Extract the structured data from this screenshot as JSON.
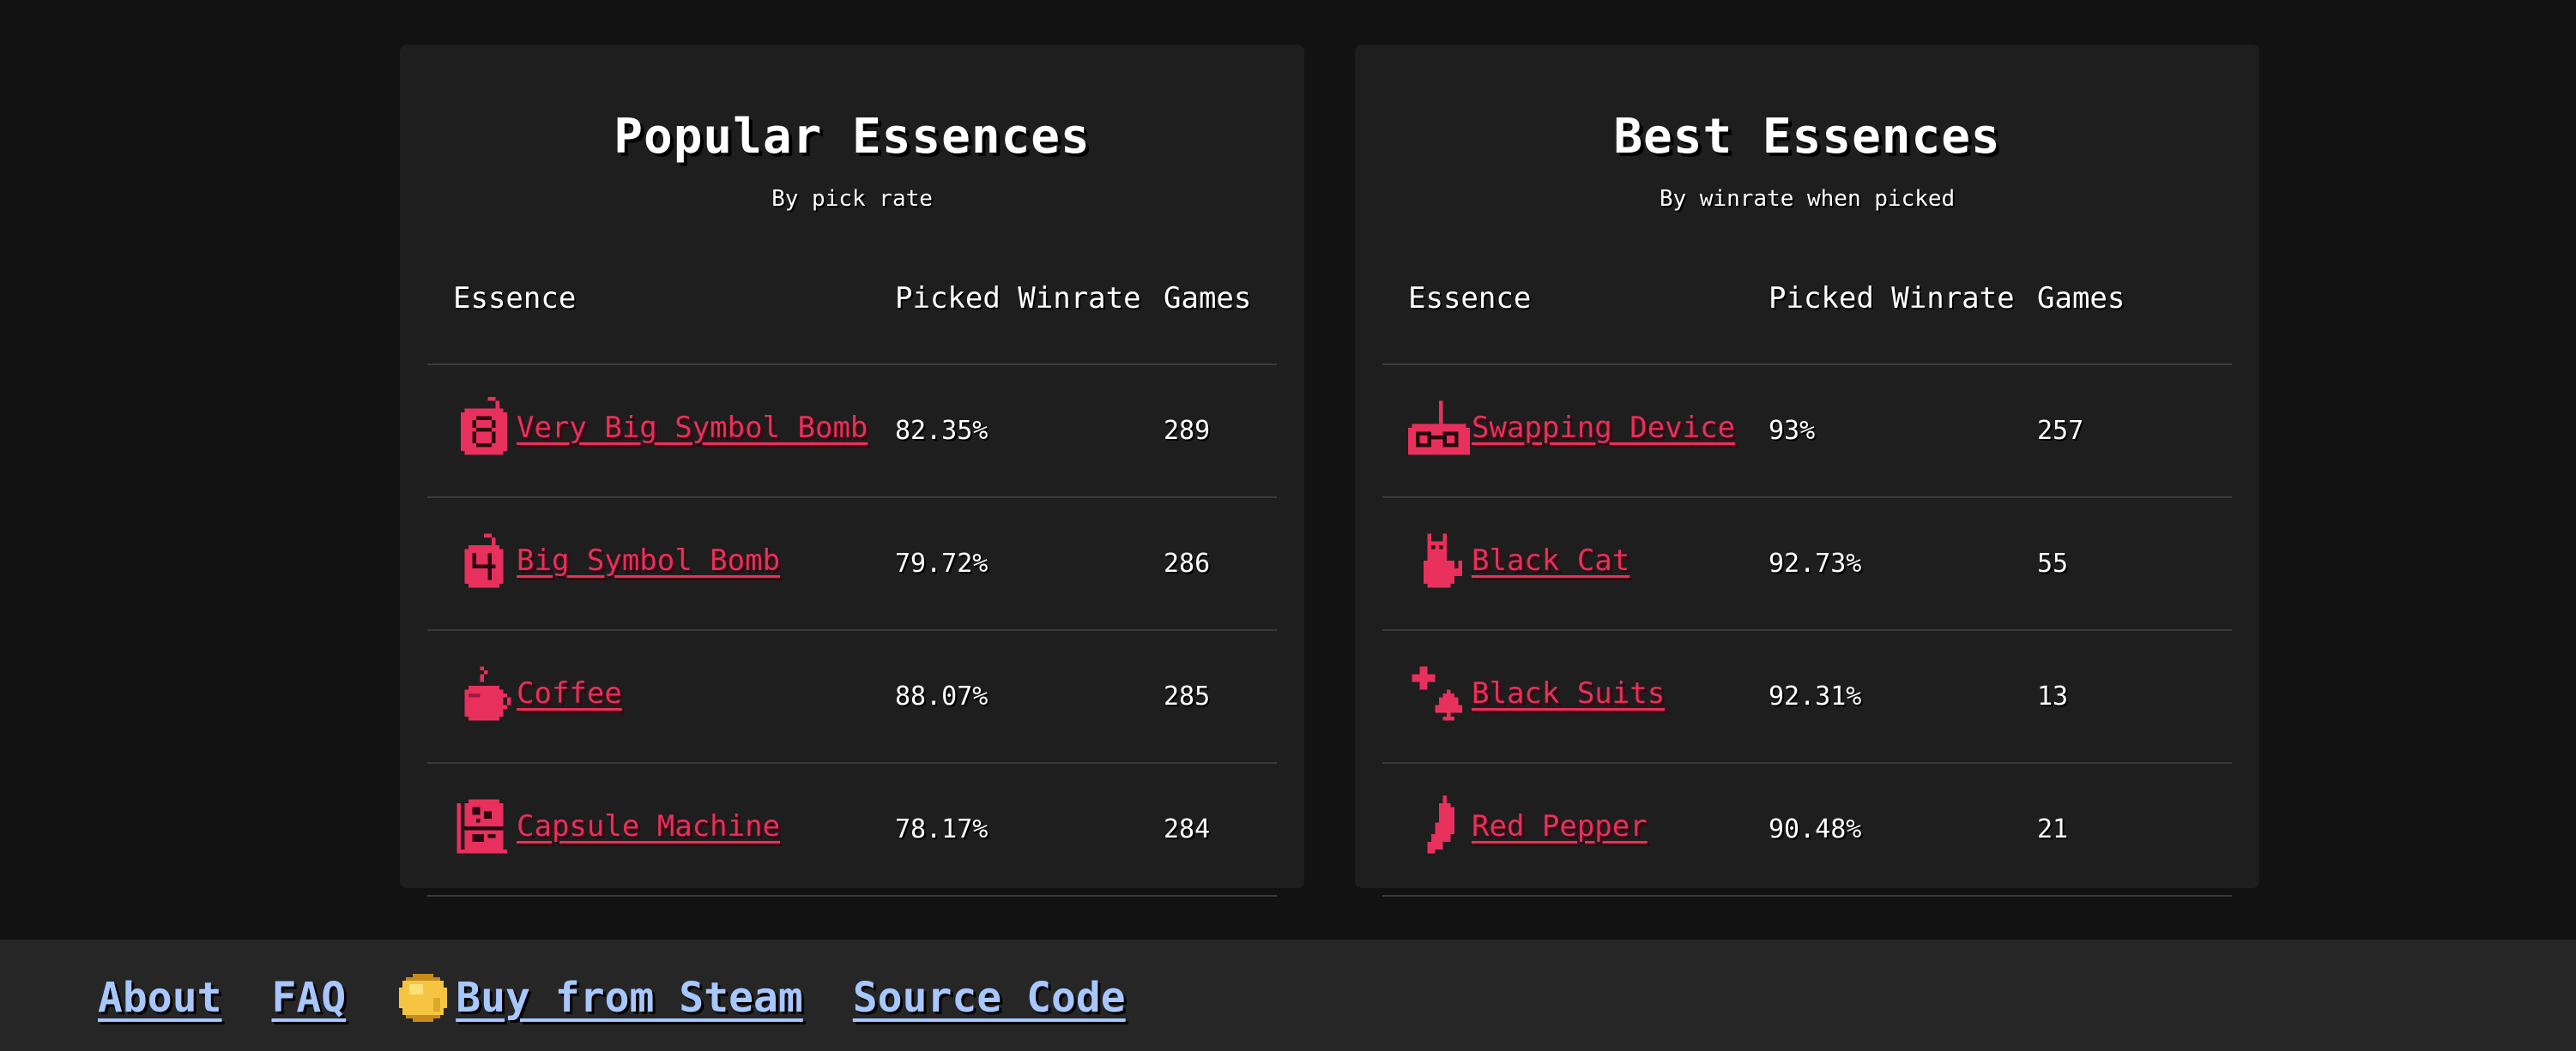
{
  "popular": {
    "title": "Popular Essences",
    "subtitle": "By pick rate",
    "columns": [
      "Essence",
      "Picked Winrate",
      "Games"
    ],
    "rows": [
      {
        "name": "Very Big Symbol Bomb",
        "icon": "number-8-bomb-icon",
        "winrate": "82.35%",
        "games": "289"
      },
      {
        "name": "Big Symbol Bomb",
        "icon": "number-4-bomb-icon",
        "winrate": "79.72%",
        "games": "286"
      },
      {
        "name": "Coffee",
        "icon": "coffee-cup-icon",
        "winrate": "88.07%",
        "games": "285"
      },
      {
        "name": "Capsule Machine",
        "icon": "capsule-machine-icon",
        "winrate": "78.17%",
        "games": "284"
      }
    ]
  },
  "best": {
    "title": "Best Essences",
    "subtitle": "By winrate when picked",
    "columns": [
      "Essence",
      "Picked Winrate",
      "Games"
    ],
    "rows": [
      {
        "name": "Swapping Device",
        "icon": "swapping-device-icon",
        "winrate": "93%",
        "games": "257"
      },
      {
        "name": "Black Cat",
        "icon": "black-cat-icon",
        "winrate": "92.73%",
        "games": "55"
      },
      {
        "name": "Black Suits",
        "icon": "card-suits-icon",
        "winrate": "92.31%",
        "games": "13"
      },
      {
        "name": "Red Pepper",
        "icon": "red-pepper-icon",
        "winrate": "90.48%",
        "games": "21"
      }
    ]
  },
  "footer": {
    "about": "About",
    "faq": "FAQ",
    "steam": "Buy from Steam",
    "steam_icon": "gold-coin-icon",
    "source": "Source Code"
  },
  "colors": {
    "background": "#121212",
    "panel": "#1e1e1e",
    "footer": "#262626",
    "essence_link": "#e8305c",
    "footer_link": "#a7c7ff",
    "row_divider": "#3a3a3a"
  }
}
